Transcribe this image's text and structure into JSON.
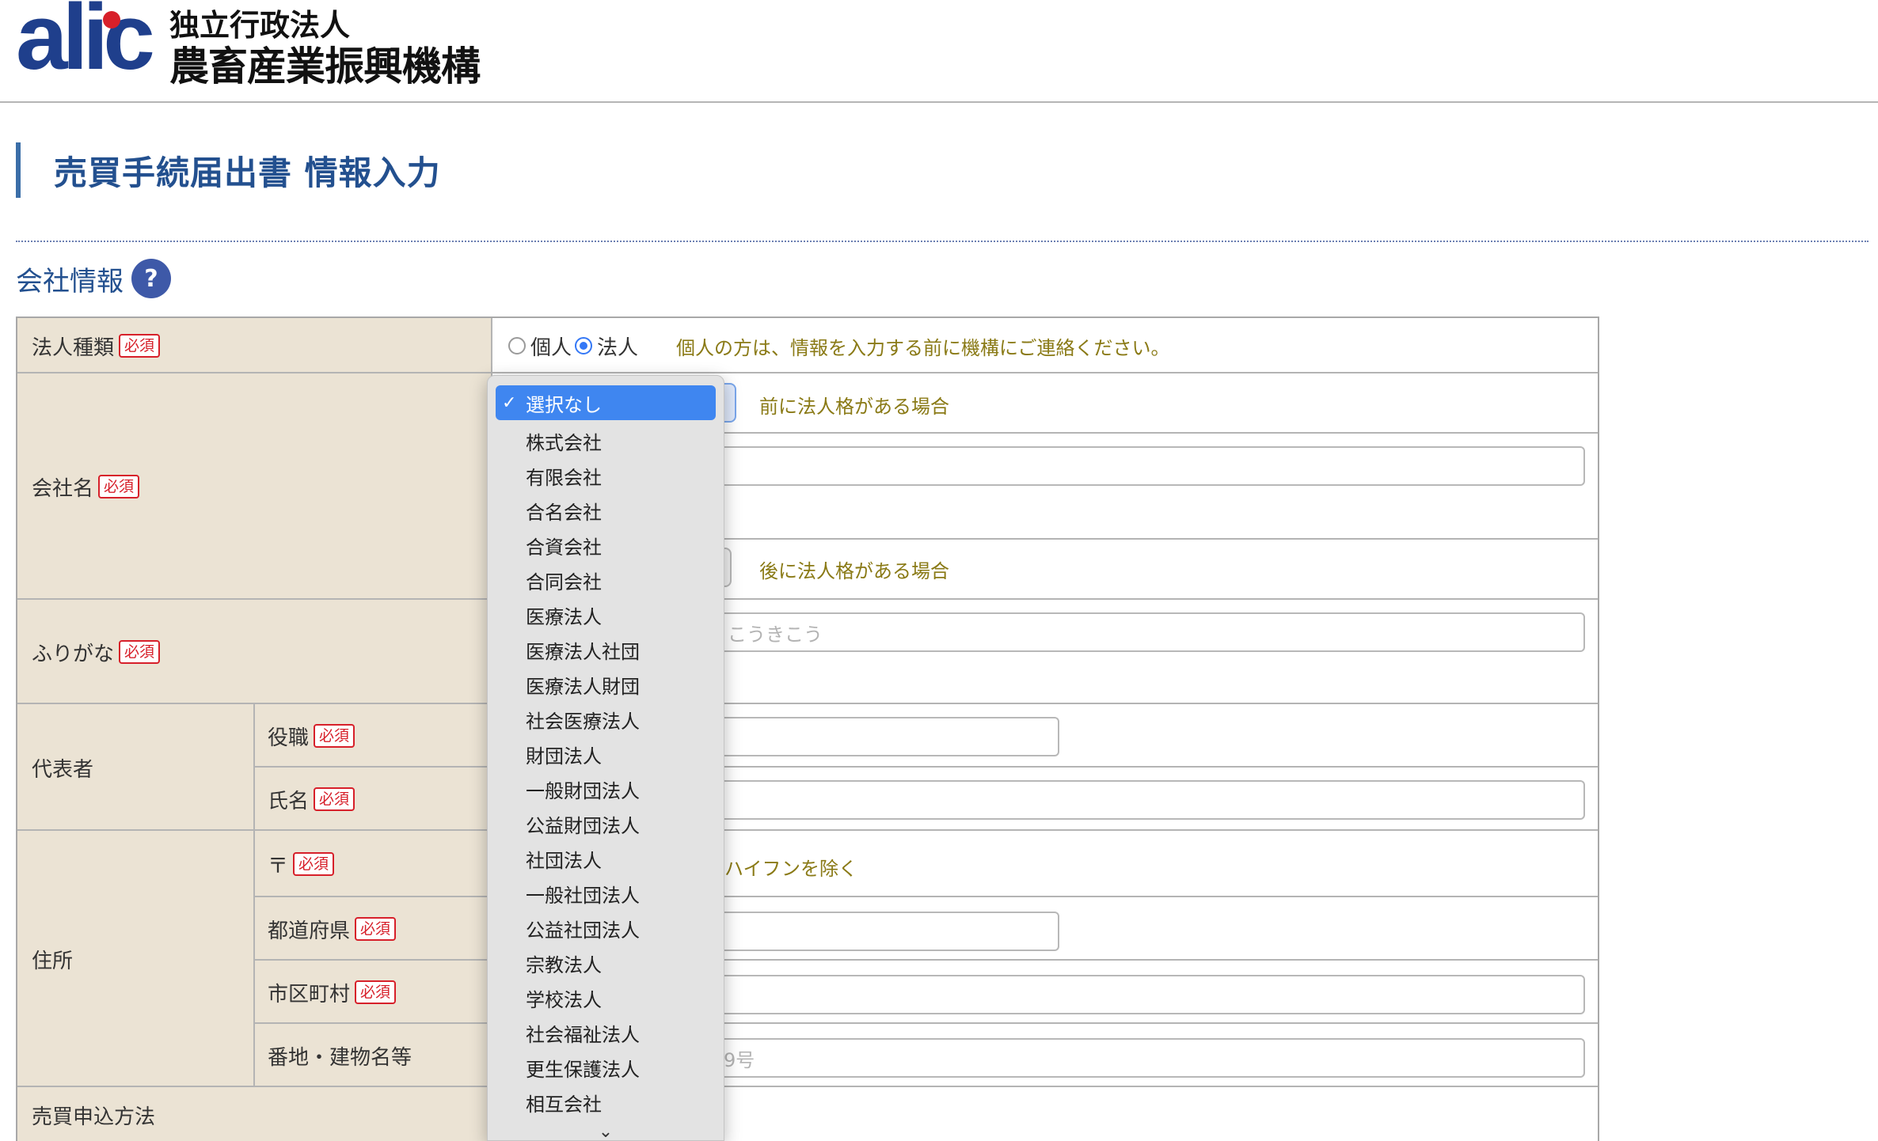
{
  "header": {
    "logo_mark": "alic",
    "org_line1": "独立行政法人",
    "org_line2": "農畜産業振興機構"
  },
  "page": {
    "title": "売買手続届出書 情報入力"
  },
  "section": {
    "title": "会社情報",
    "help_icon": "?"
  },
  "required_badge": "必須",
  "form": {
    "corp_type": {
      "label": "法人種類",
      "options": [
        "個人",
        "法人"
      ],
      "selected": "法人",
      "note": "個人の方は、情報を入力する前に機構にご連絡ください。"
    },
    "company_name": {
      "label": "会社名",
      "prefix_note": "前に法人格がある場合",
      "suffix_note": "後に法人格がある場合"
    },
    "furigana": {
      "label": "ふりがな",
      "placeholder_fragment": "こうきこう"
    },
    "representative": {
      "label": "代表者",
      "title_label": "役職",
      "name_label": "氏名"
    },
    "address": {
      "label": "住所",
      "postal_label": "〒",
      "postal_note": "ハイフンを除く",
      "prefecture_label": "都道府県",
      "city_label": "市区町村",
      "street_label": "番地・建物名等",
      "street_placeholder_fragment": "9号"
    },
    "sale_method": {
      "label": "売買申込方法"
    }
  },
  "dropdown": {
    "selected": "選択なし",
    "check_icon": "✓",
    "more_icon": "⌄",
    "options": [
      "株式会社",
      "有限会社",
      "合名会社",
      "合資会社",
      "合同会社",
      "医療法人",
      "医療法人社団",
      "医療法人財団",
      "社会医療法人",
      "財団法人",
      "一般財団法人",
      "公益財団法人",
      "社団法人",
      "一般社団法人",
      "公益社団法人",
      "宗教法人",
      "学校法人",
      "社会福祉法人",
      "更生保護法人",
      "相互会社"
    ]
  },
  "colors": {
    "brand_navy": "#1f3f8c",
    "brand_red": "#d7202a",
    "label_bg": "#ebe3d4",
    "note_olive": "#8a7a16",
    "select_blue": "#3f86f0"
  }
}
